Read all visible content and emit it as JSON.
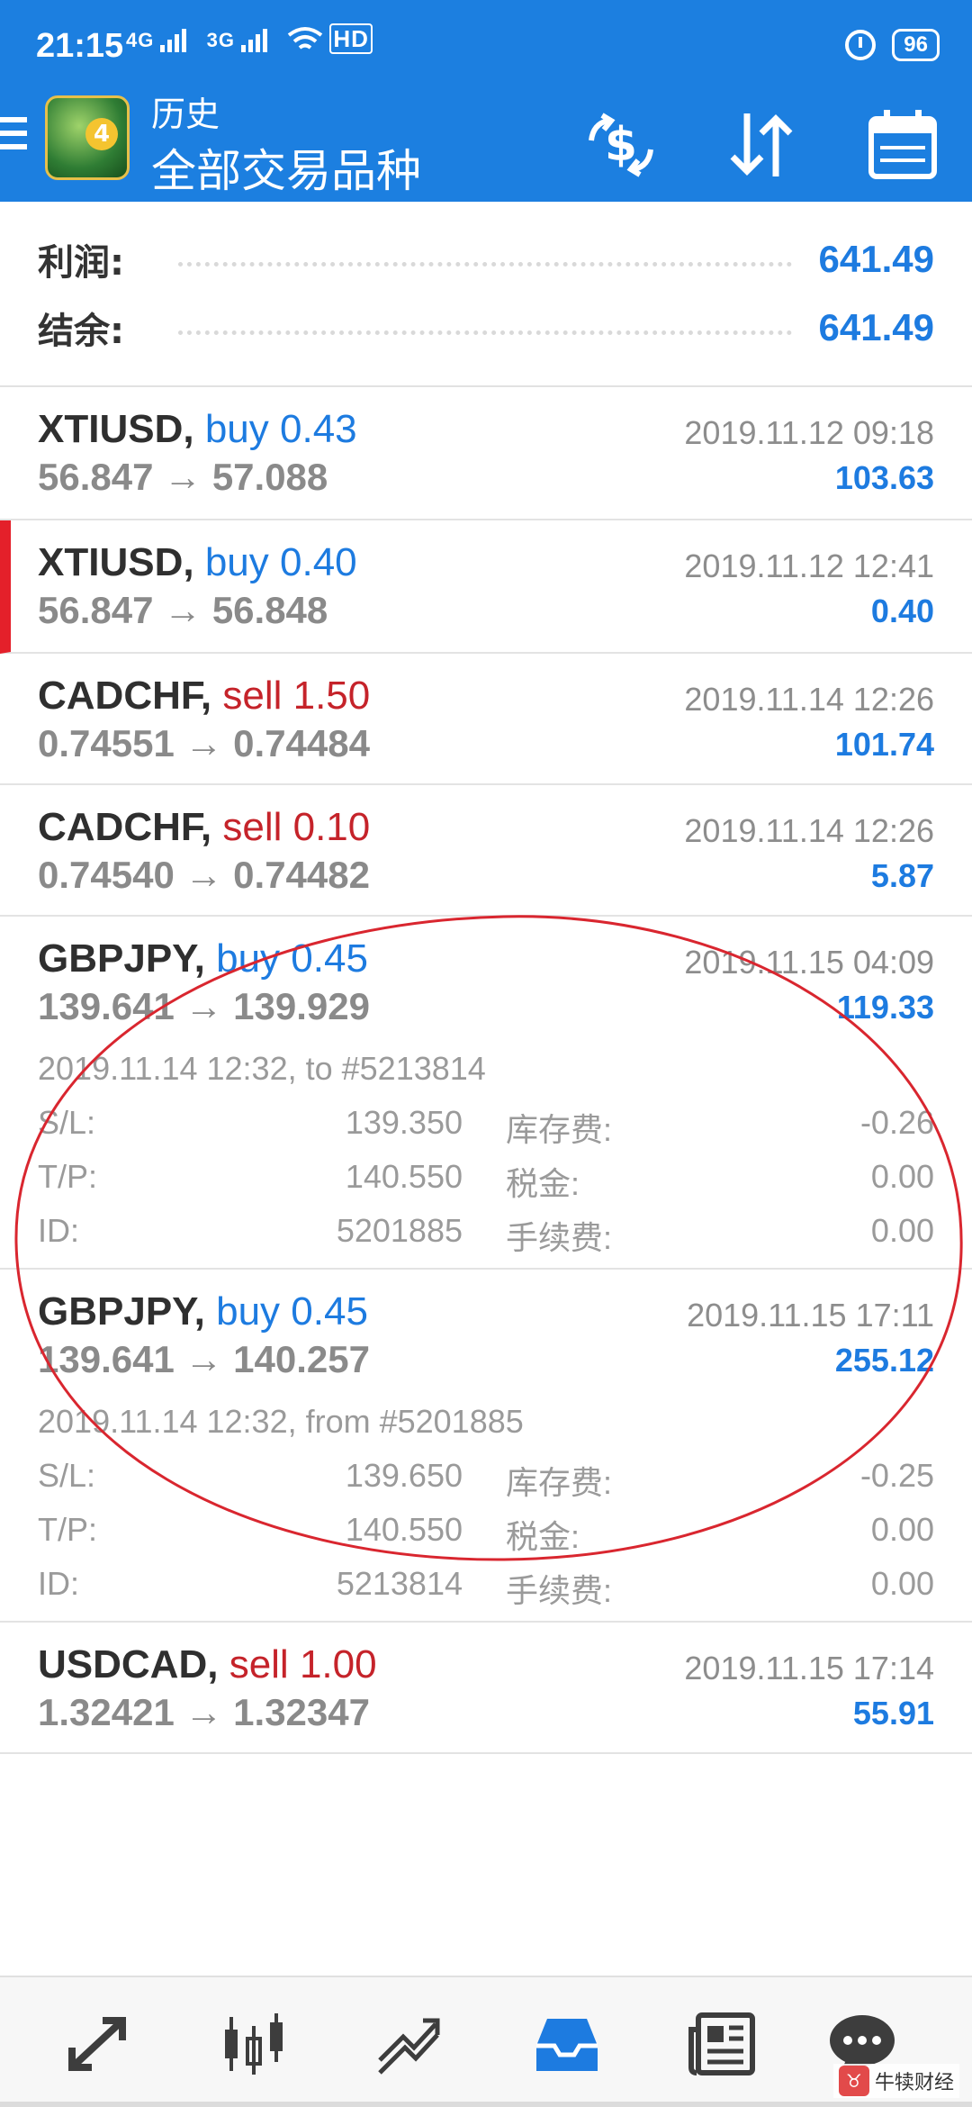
{
  "status_bar": {
    "time": "21:15",
    "net1": "4G",
    "net2": "3G",
    "wifi_tag": "HD",
    "battery": "96"
  },
  "header": {
    "title": "历史",
    "subtitle": "全部交易品种",
    "icons": [
      "menu-icon",
      "currency-icon",
      "sort-icon",
      "calendar-icon"
    ]
  },
  "summary": {
    "profit_label": "利润:",
    "profit_value": "641.49",
    "balance_label": "结余:",
    "balance_value": "641.49"
  },
  "trades": [
    {
      "symbol": "XTIUSD,",
      "side": "buy",
      "volume": "0.43",
      "time": "2019.11.12 09:18",
      "open": "56.847",
      "close": "57.088",
      "profit": "103.63"
    },
    {
      "symbol": "XTIUSD,",
      "side": "buy",
      "volume": "0.40",
      "time": "2019.11.12 12:41",
      "open": "56.847",
      "close": "56.848",
      "profit": "0.40"
    },
    {
      "symbol": "CADCHF,",
      "side": "sell",
      "volume": "1.50",
      "time": "2019.11.14 12:26",
      "open": "0.74551",
      "close": "0.74484",
      "profit": "101.74"
    },
    {
      "symbol": "CADCHF,",
      "side": "sell",
      "volume": "0.10",
      "time": "2019.11.14 12:26",
      "open": "0.74540",
      "close": "0.74482",
      "profit": "5.87"
    },
    {
      "symbol": "GBPJPY,",
      "side": "buy",
      "volume": "0.45",
      "time": "2019.11.15 04:09",
      "open": "139.641",
      "close": "139.929",
      "profit": "119.33",
      "details": {
        "open_info": "2019.11.14 12:32, to #5213814",
        "sl_label": "S/L:",
        "sl": "139.350",
        "tp_label": "T/P:",
        "tp": "140.550",
        "id_label": "ID:",
        "id": "5201885",
        "swap_label": "库存费:",
        "swap": "-0.26",
        "tax_label": "税金:",
        "tax": "0.00",
        "fee_label": "手续费:",
        "fee": "0.00"
      }
    },
    {
      "symbol": "GBPJPY,",
      "side": "buy",
      "volume": "0.45",
      "time": "2019.11.15 17:11",
      "open": "139.641",
      "close": "140.257",
      "profit": "255.12",
      "details": {
        "open_info": "2019.11.14 12:32, from #5201885",
        "sl_label": "S/L:",
        "sl": "139.650",
        "tp_label": "T/P:",
        "tp": "140.550",
        "id_label": "ID:",
        "id": "5213814",
        "swap_label": "库存费:",
        "swap": "-0.25",
        "tax_label": "税金:",
        "tax": "0.00",
        "fee_label": "手续费:",
        "fee": "0.00"
      }
    },
    {
      "symbol": "USDCAD,",
      "side": "sell",
      "volume": "1.00",
      "time": "2019.11.15 17:14",
      "open": "1.32421",
      "close": "1.32347",
      "profit": "55.91"
    }
  ],
  "arrow": "→",
  "bottom_nav": [
    "quotes-icon",
    "chart-icon",
    "trade-icon",
    "history-icon",
    "news-icon",
    "chat-icon"
  ],
  "watermark": "牛犊财经",
  "colors": {
    "header_bg": "#1c7fe0",
    "buy": "#1d7be0",
    "sell": "#c5232a",
    "profit": "#1d7be0",
    "annotation": "#d9262f"
  }
}
